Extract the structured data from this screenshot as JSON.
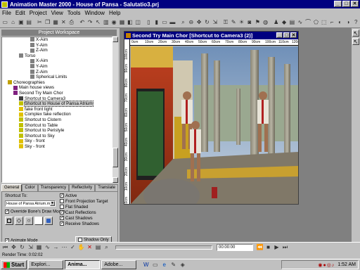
{
  "app": {
    "title": "Animation Master 2000 - House of Pansa - Salutatio3.prj"
  },
  "menu": [
    "File",
    "Edit",
    "Project",
    "View",
    "Tools",
    "Window",
    "Help"
  ],
  "project_workspace": {
    "title": "Project Workspace",
    "tree": [
      {
        "label": "X-Aim",
        "indent": 5,
        "icon": "bone"
      },
      {
        "label": "Y-Aim",
        "indent": 5,
        "icon": "bone"
      },
      {
        "label": "Z-Aim",
        "indent": 5,
        "icon": "bone"
      },
      {
        "label": "Torso",
        "indent": 3,
        "icon": "bone"
      },
      {
        "label": "X-Aim",
        "indent": 5,
        "icon": "bone"
      },
      {
        "label": "Y-Aim",
        "indent": 5,
        "icon": "bone"
      },
      {
        "label": "Z-Aim",
        "indent": 5,
        "icon": "bone"
      },
      {
        "label": "Spherical Limits",
        "indent": 5,
        "icon": "bone"
      },
      {
        "label": "Choreographies",
        "indent": 1,
        "icon": "folder"
      },
      {
        "label": "Main house views",
        "indent": 2,
        "icon": "chor"
      },
      {
        "label": "Second Try Main Chor",
        "indent": 2,
        "icon": "chor"
      },
      {
        "label": "Shortcut to Camera3",
        "indent": 3,
        "icon": "camera"
      },
      {
        "label": "Shortcut to House of Pansa Atrium",
        "indent": 3,
        "icon": "model",
        "selected": true
      },
      {
        "label": "fake front light",
        "indent": 3,
        "icon": "light"
      },
      {
        "label": "Complex fake reflection",
        "indent": 3,
        "icon": "light"
      },
      {
        "label": "Shortcut to Cistern",
        "indent": 3,
        "icon": "model"
      },
      {
        "label": "Shortcut to Table",
        "indent": 3,
        "icon": "model"
      },
      {
        "label": "Shortcut to Peristyle",
        "indent": 3,
        "icon": "model"
      },
      {
        "label": "Shortcut to Sky",
        "indent": 3,
        "icon": "model"
      },
      {
        "label": "Sky - front",
        "indent": 3,
        "icon": "light"
      },
      {
        "label": "Sky - front",
        "indent": 3,
        "icon": "light"
      }
    ]
  },
  "tabs": [
    "General",
    "Color",
    "Transparency",
    "Reflectivity",
    "Translate"
  ],
  "props": {
    "shortcut_to_label": "Shortcut To:",
    "shortcut_value": "House of Pansa Atrium.mdl",
    "override_label": "Override Bone's Draw Modes",
    "animate_mode": "Animate Mode",
    "checks": [
      {
        "label": "Active",
        "checked": true
      },
      {
        "label": "Front Projection Target",
        "checked": false
      },
      {
        "label": "Flat Shaded",
        "checked": false
      },
      {
        "label": "Cast Reflections",
        "checked": true
      },
      {
        "label": "Cast Shadows",
        "checked": true
      },
      {
        "label": "Receive Shadows",
        "checked": true
      }
    ],
    "shadow_only": "Shadow Only"
  },
  "child_window": {
    "title": "Second Try Main Chor [Shortcut to Camera3 (2)]",
    "ruler_top": [
      "0cm",
      "10cm",
      "20cm",
      "30cm",
      "40cm",
      "50cm",
      "60cm",
      "70cm",
      "80cm",
      "90cm",
      "100cm",
      "110cm",
      "120cm"
    ],
    "ruler_left": [
      "100cm",
      "90cm",
      "80cm",
      "70cm",
      "60cm",
      "50cm",
      "40cm",
      "30cm",
      "20cm",
      "10cm",
      "0cm"
    ]
  },
  "timebar": {
    "time_value": "00:00:00"
  },
  "status": {
    "text": "Render Time: 0:02:02"
  },
  "taskbar": {
    "start": "Start",
    "tasks": [
      "Explori...",
      "Anima...",
      "Adobe..."
    ],
    "clock": "1:52 AM"
  },
  "colors": {
    "titlebar": "#000080",
    "face": "#c0c0c0",
    "desktop": "#808080"
  }
}
